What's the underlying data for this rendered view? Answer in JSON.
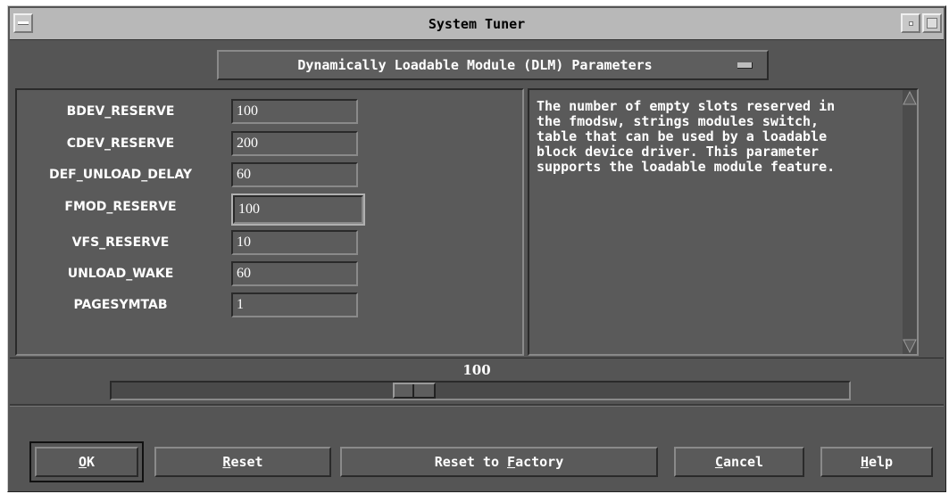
{
  "window": {
    "title": "System Tuner"
  },
  "category_menu": {
    "selected": "Dynamically Loadable Module (DLM) Parameters"
  },
  "parameters": [
    {
      "name": "BDEV_RESERVE",
      "value": "100"
    },
    {
      "name": "CDEV_RESERVE",
      "value": "200"
    },
    {
      "name": "DEF_UNLOAD_DELAY",
      "value": "60"
    },
    {
      "name": "FMOD_RESERVE",
      "value": "100"
    },
    {
      "name": "VFS_RESERVE",
      "value": "10"
    },
    {
      "name": "UNLOAD_WAKE",
      "value": "60"
    },
    {
      "name": "PAGESYMTAB",
      "value": "1"
    }
  ],
  "description": "The number of empty slots reserved in\nthe fmodsw, strings modules switch,\ntable that can be used by a loadable\nblock device driver. This parameter\nsupports the loadable module feature.",
  "slider": {
    "value": "100",
    "position_fraction": 0.405
  },
  "buttons": {
    "ok": {
      "pre": "",
      "mnemonic": "O",
      "post": "K"
    },
    "reset": {
      "pre": "",
      "mnemonic": "R",
      "post": "eset"
    },
    "reset_factory": {
      "pre": "Reset to ",
      "mnemonic": "F",
      "post": "actory"
    },
    "cancel": {
      "pre": "",
      "mnemonic": "C",
      "post": "ancel"
    },
    "help": {
      "pre": "",
      "mnemonic": "H",
      "post": "elp"
    }
  },
  "colors": {
    "background": "#555555",
    "titlebar": "#b8b8b8",
    "text": "#ffffff"
  }
}
